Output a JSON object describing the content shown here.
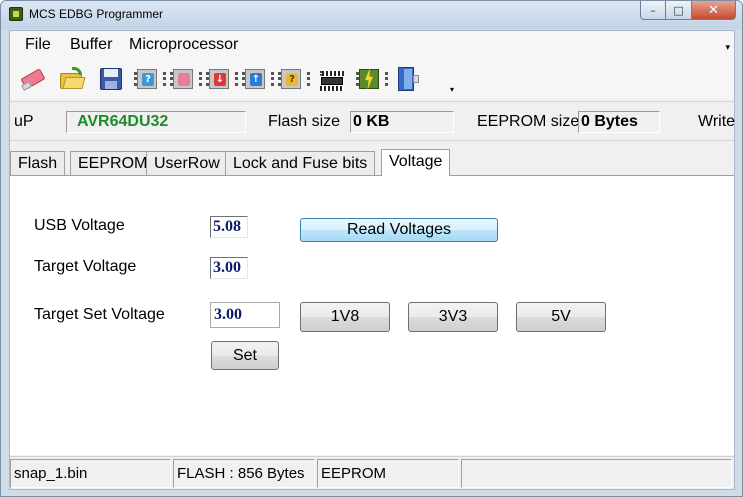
{
  "window": {
    "title": "MCS EDBG Programmer",
    "min_glyph": "–",
    "max_glyph": "□",
    "close_glyph": "✕"
  },
  "menu": {
    "items": [
      "File",
      "Buffer",
      "Microprocessor"
    ],
    "more_glyph": "▾"
  },
  "toolbar": {
    "buttons": [
      "erase-icon",
      "open-folder-icon",
      "save-disk-icon",
      "chip-identify-icon",
      "chip-erase-icon",
      "chip-read-icon",
      "chip-write-icon",
      "chip-verify-icon",
      "chip-lock-fuse-icon",
      "auto-program-icon",
      "exit-door-icon"
    ],
    "question_glyph": "?",
    "down_glyph": "↓",
    "up_glyph": "↑",
    "more_glyph": "▾"
  },
  "info": {
    "up_label": "uP",
    "up_value": "AVR64DU32",
    "up_value_color": "#1f8a2a",
    "flash_label": "Flash size",
    "flash_value": "0 KB",
    "eeprom_label": "EEPROM size",
    "eeprom_value": "0 Bytes",
    "write_label": "Write"
  },
  "tabs": [
    "Flash",
    "EEPROM",
    "UserRow",
    "Lock and Fuse bits",
    "Voltage"
  ],
  "active_tab": "Voltage",
  "voltage": {
    "usb_label": "USB Voltage",
    "usb_value": "5.08",
    "target_label": "Target Voltage",
    "target_value": "3.00",
    "set_label": "Target Set Voltage",
    "set_value": "3.00",
    "read_button": "Read Voltages",
    "preset_1v8": "1V8",
    "preset_3v3": "3V3",
    "preset_5v": "5V",
    "set_button": "Set"
  },
  "status": {
    "file": "snap_1.bin",
    "flash": "FLASH : 856 Bytes",
    "eeprom": "EEPROM"
  },
  "colors": {
    "accent_blue": "#a7d9f5",
    "value_text": "#0a1a6a",
    "close_red": "#c44b32"
  }
}
